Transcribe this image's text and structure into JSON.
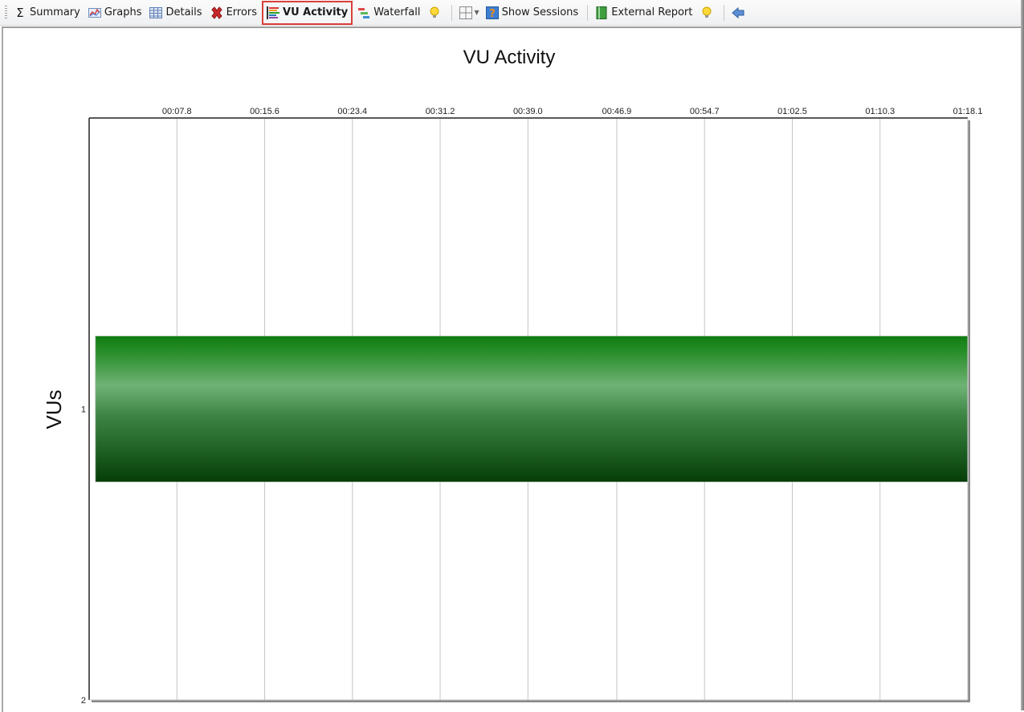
{
  "toolbar": {
    "items": [
      {
        "label": "Summary",
        "icon": "sigma-icon"
      },
      {
        "label": "Graphs",
        "icon": "graph-icon"
      },
      {
        "label": "Details",
        "icon": "table-icon"
      },
      {
        "label": "Errors",
        "icon": "error-x-icon"
      },
      {
        "label": "VU Activity",
        "icon": "vu-activity-icon",
        "active": true
      },
      {
        "label": "Waterfall",
        "icon": "waterfall-icon"
      }
    ],
    "hint_icon": "lightbulb-icon",
    "layout_icon": "grid-layout-icon",
    "show_sessions_label": "Show Sessions",
    "external_report_label": "External Report",
    "back_icon": "back-arrow-icon",
    "active_highlight_color": "#d9403a"
  },
  "chart_data": {
    "type": "gantt-bar",
    "title": "VU Activity",
    "xlabel": "",
    "ylabel": "VUs",
    "x_unit": "seconds (mm:ss.s)",
    "x_ticks": [
      "00:07.8",
      "00:15.6",
      "00:23.4",
      "00:31.2",
      "00:39.0",
      "00:46.9",
      "00:54.7",
      "01:02.5",
      "01:10.3",
      "01:18.1"
    ],
    "x_tick_values": [
      7.8,
      15.6,
      23.4,
      31.2,
      39.0,
      46.9,
      54.7,
      62.5,
      70.3,
      78.1
    ],
    "xlim": [
      0,
      78.1
    ],
    "y_ticks": [
      "1",
      "2"
    ],
    "y_tick_values": [
      1,
      2
    ],
    "ylim": [
      0,
      2
    ],
    "x_axis_position": "top",
    "grid": "vertical",
    "series": [
      {
        "name": "VU 1",
        "vu": 1,
        "start": 0.3,
        "end": 78.1,
        "color": "#1a8a1a"
      }
    ]
  }
}
